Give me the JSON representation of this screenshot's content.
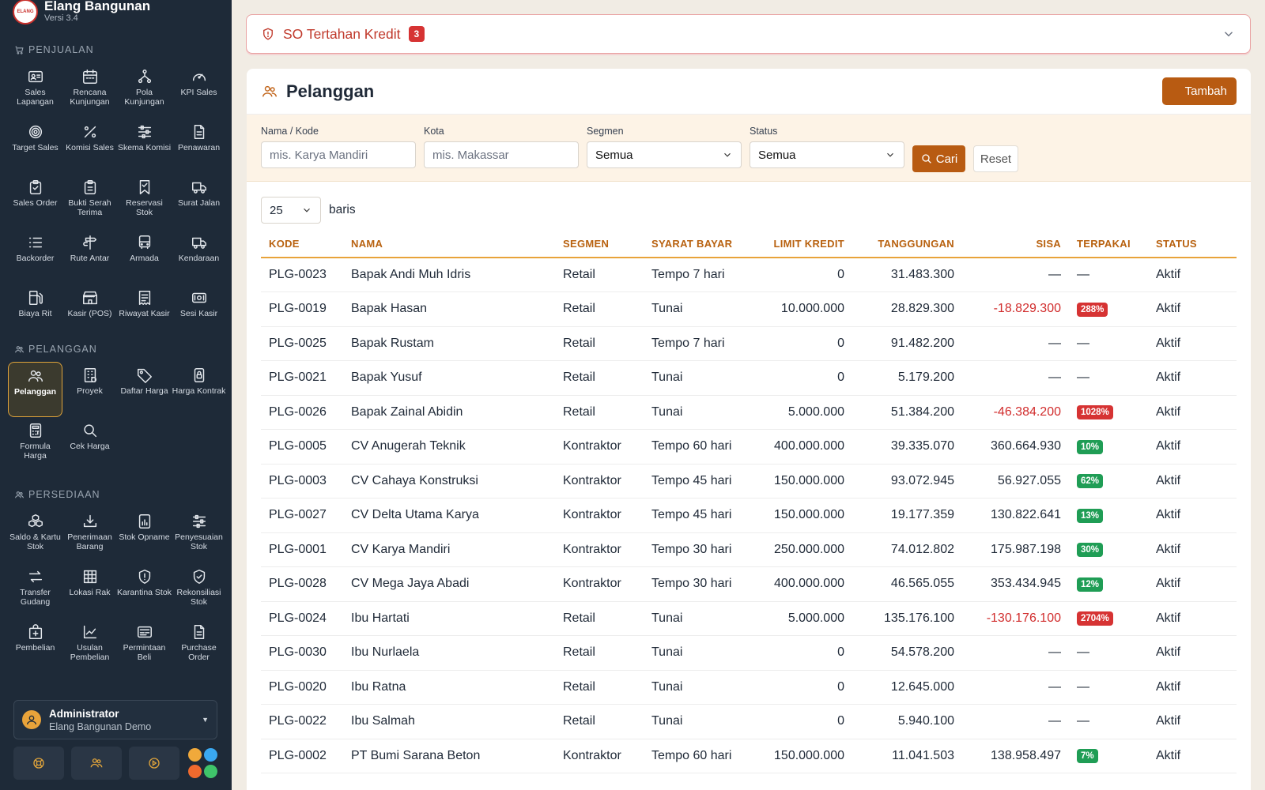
{
  "app": {
    "title": "Elang Bangunan",
    "version": "Versi 3.4",
    "logo_text": "ELANG"
  },
  "sidebar": {
    "sections": [
      {
        "title": "PENJUALAN",
        "icon": "cart-icon",
        "items": [
          {
            "label": "Sales Lapangan",
            "icon": "id-card-icon"
          },
          {
            "label": "Rencana Kunjungan",
            "icon": "calendar-icon"
          },
          {
            "label": "Pola Kunjungan",
            "icon": "nodes-icon"
          },
          {
            "label": "KPI Sales",
            "icon": "gauge-icon"
          },
          {
            "label": "Target Sales",
            "icon": "target-icon"
          },
          {
            "label": "Komisi Sales",
            "icon": "percent-icon"
          },
          {
            "label": "Skema Komisi",
            "icon": "sliders-icon"
          },
          {
            "label": "Penawaran",
            "icon": "document-icon"
          },
          {
            "label": "Sales Order",
            "icon": "clipboard-icon"
          },
          {
            "label": "Bukti Serah Terima",
            "icon": "clipboard-check-icon"
          },
          {
            "label": "Reservasi Stok",
            "icon": "bookmark-icon"
          },
          {
            "label": "Surat Jalan",
            "icon": "truck-icon"
          },
          {
            "label": "Backorder",
            "icon": "list-icon"
          },
          {
            "label": "Rute Antar",
            "icon": "signpost-icon"
          },
          {
            "label": "Armada",
            "icon": "bus-icon"
          },
          {
            "label": "Kendaraan",
            "icon": "truck-icon"
          },
          {
            "label": "Biaya Rit",
            "icon": "fuel-icon"
          },
          {
            "label": "Kasir (POS)",
            "icon": "shop-icon"
          },
          {
            "label": "Riwayat Kasir",
            "icon": "receipt-icon"
          },
          {
            "label": "Sesi Kasir",
            "icon": "cash-icon"
          }
        ]
      },
      {
        "title": "PELANGGAN",
        "icon": "people-icon",
        "items": [
          {
            "label": "Pelanggan",
            "icon": "people-icon",
            "active": true
          },
          {
            "label": "Proyek",
            "icon": "building-icon"
          },
          {
            "label": "Daftar Harga",
            "icon": "tag-icon"
          },
          {
            "label": "Harga Kontrak",
            "icon": "lock-icon"
          },
          {
            "label": "Formula Harga",
            "icon": "calculator-icon"
          },
          {
            "label": "Cek Harga",
            "icon": "search-icon"
          }
        ]
      },
      {
        "title": "PERSEDIAAN",
        "icon": "people-icon",
        "items": [
          {
            "label": "Saldo & Kartu Stok",
            "icon": "boxes-icon"
          },
          {
            "label": "Penerimaan Barang",
            "icon": "download-icon"
          },
          {
            "label": "Stok Opname",
            "icon": "chart-doc-icon"
          },
          {
            "label": "Penyesuaian Stok",
            "icon": "sliders-icon"
          },
          {
            "label": "Transfer Gudang",
            "icon": "arrows-icon"
          },
          {
            "label": "Lokasi Rak",
            "icon": "grid-icon"
          },
          {
            "label": "Karantina Stok",
            "icon": "shield-icon"
          },
          {
            "label": "Rekonsiliasi Stok",
            "icon": "shield-check-icon"
          },
          {
            "label": "Pembelian",
            "icon": "bag-plus-icon"
          },
          {
            "label": "Usulan Pembelian",
            "icon": "graph-icon"
          },
          {
            "label": "Permintaan Beli",
            "icon": "form-icon"
          },
          {
            "label": "Purchase Order",
            "icon": "document-icon"
          }
        ]
      }
    ],
    "user": {
      "name": "Administrator",
      "company": "Elang Bangunan Demo"
    },
    "dot_colors": [
      "#f0a93b",
      "#3aa8f0",
      "#f06a2e",
      "#3fc46a"
    ]
  },
  "alert": {
    "title": "SO Tertahan Kredit",
    "count": "3"
  },
  "page": {
    "title": "Pelanggan",
    "add_label": "Tambah",
    "filters": {
      "name_label": "Nama / Kode",
      "name_placeholder": "mis. Karya Mandiri",
      "city_label": "Kota",
      "city_placeholder": "mis. Makassar",
      "segment_label": "Segmen",
      "segment_value": "Semua",
      "status_label": "Status",
      "status_value": "Semua",
      "search_label": "Cari",
      "reset_label": "Reset"
    },
    "rows_per_page": "25",
    "rows_label": "baris"
  },
  "table": {
    "columns": [
      "KODE",
      "NAMA",
      "SEGMEN",
      "SYARAT BAYAR",
      "LIMIT KREDIT",
      "TANGGUNGAN",
      "SISA",
      "TERPAKAI",
      "STATUS"
    ],
    "rows": [
      {
        "kode": "PLG-0023",
        "nama": "Bapak Andi Muh Idris",
        "segmen": "Retail",
        "syarat": "Tempo 7 hari",
        "limit": "0",
        "tanggungan": "31.483.300",
        "sisa": "—",
        "terpakai": "—",
        "status": "Aktif"
      },
      {
        "kode": "PLG-0019",
        "nama": "Bapak Hasan",
        "segmen": "Retail",
        "syarat": "Tunai",
        "limit": "10.000.000",
        "tanggungan": "28.829.300",
        "sisa": "-18.829.300",
        "terpakai": "288%",
        "status": "Aktif",
        "level": "over"
      },
      {
        "kode": "PLG-0025",
        "nama": "Bapak Rustam",
        "segmen": "Retail",
        "syarat": "Tempo 7 hari",
        "limit": "0",
        "tanggungan": "91.482.200",
        "sisa": "—",
        "terpakai": "—",
        "status": "Aktif"
      },
      {
        "kode": "PLG-0021",
        "nama": "Bapak Yusuf",
        "segmen": "Retail",
        "syarat": "Tunai",
        "limit": "0",
        "tanggungan": "5.179.200",
        "sisa": "—",
        "terpakai": "—",
        "status": "Aktif"
      },
      {
        "kode": "PLG-0026",
        "nama": "Bapak Zainal Abidin",
        "segmen": "Retail",
        "syarat": "Tunai",
        "limit": "5.000.000",
        "tanggungan": "51.384.200",
        "sisa": "-46.384.200",
        "terpakai": "1028%",
        "status": "Aktif",
        "level": "over"
      },
      {
        "kode": "PLG-0005",
        "nama": "CV Anugerah Teknik",
        "segmen": "Kontraktor",
        "syarat": "Tempo 60 hari",
        "limit": "400.000.000",
        "tanggungan": "39.335.070",
        "sisa": "360.664.930",
        "terpakai": "10%",
        "status": "Aktif",
        "level": "ok"
      },
      {
        "kode": "PLG-0003",
        "nama": "CV Cahaya Konstruksi",
        "segmen": "Kontraktor",
        "syarat": "Tempo 45 hari",
        "limit": "150.000.000",
        "tanggungan": "93.072.945",
        "sisa": "56.927.055",
        "terpakai": "62%",
        "status": "Aktif",
        "level": "ok"
      },
      {
        "kode": "PLG-0027",
        "nama": "CV Delta Utama Karya",
        "segmen": "Kontraktor",
        "syarat": "Tempo 45 hari",
        "limit": "150.000.000",
        "tanggungan": "19.177.359",
        "sisa": "130.822.641",
        "terpakai": "13%",
        "status": "Aktif",
        "level": "ok"
      },
      {
        "kode": "PLG-0001",
        "nama": "CV Karya Mandiri",
        "segmen": "Kontraktor",
        "syarat": "Tempo 30 hari",
        "limit": "250.000.000",
        "tanggungan": "74.012.802",
        "sisa": "175.987.198",
        "terpakai": "30%",
        "status": "Aktif",
        "level": "ok"
      },
      {
        "kode": "PLG-0028",
        "nama": "CV Mega Jaya Abadi",
        "segmen": "Kontraktor",
        "syarat": "Tempo 30 hari",
        "limit": "400.000.000",
        "tanggungan": "46.565.055",
        "sisa": "353.434.945",
        "terpakai": "12%",
        "status": "Aktif",
        "level": "ok"
      },
      {
        "kode": "PLG-0024",
        "nama": "Ibu Hartati",
        "segmen": "Retail",
        "syarat": "Tunai",
        "limit": "5.000.000",
        "tanggungan": "135.176.100",
        "sisa": "-130.176.100",
        "terpakai": "2704%",
        "status": "Aktif",
        "level": "over"
      },
      {
        "kode": "PLG-0030",
        "nama": "Ibu Nurlaela",
        "segmen": "Retail",
        "syarat": "Tunai",
        "limit": "0",
        "tanggungan": "54.578.200",
        "sisa": "—",
        "terpakai": "—",
        "status": "Aktif"
      },
      {
        "kode": "PLG-0020",
        "nama": "Ibu Ratna",
        "segmen": "Retail",
        "syarat": "Tunai",
        "limit": "0",
        "tanggungan": "12.645.000",
        "sisa": "—",
        "terpakai": "—",
        "status": "Aktif"
      },
      {
        "kode": "PLG-0022",
        "nama": "Ibu Salmah",
        "segmen": "Retail",
        "syarat": "Tunai",
        "limit": "0",
        "tanggungan": "5.940.100",
        "sisa": "—",
        "terpakai": "—",
        "status": "Aktif"
      },
      {
        "kode": "PLG-0002",
        "nama": "PT Bumi Sarana Beton",
        "segmen": "Kontraktor",
        "syarat": "Tempo 60 hari",
        "limit": "150.000.000",
        "tanggungan": "11.041.503",
        "sisa": "138.958.497",
        "terpakai": "7%",
        "status": "Aktif",
        "level": "ok"
      }
    ],
    "colors": {
      "ok": "#1f9d55",
      "over": "#d63333",
      "negative": "#d12d2d"
    }
  }
}
